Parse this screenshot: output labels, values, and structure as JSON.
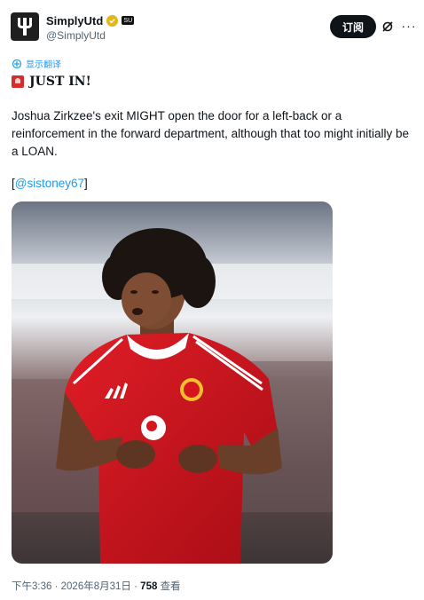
{
  "account": {
    "display_name": "SimplyUtd",
    "handle": "@SimplyUtd",
    "affiliate_label": "SU"
  },
  "actions": {
    "subscribe_label": "订阅",
    "more_label": "···"
  },
  "translate_label": "显示翻译",
  "tweet": {
    "headline": "JUST IN!",
    "body": "Joshua Zirkzee's exit MIGHT open the door for a left-back or a reinforcement in the forward department, although that too might initially be a LOAN.",
    "mention_open": "[",
    "mention": "@sistoney67",
    "mention_close": "]"
  },
  "meta": {
    "time": "下午3:36",
    "date": "2026年8月31日",
    "separator": "·",
    "views_count": "758",
    "views_label": "查看"
  },
  "colors": {
    "link": "#1d9bf0",
    "subscribe_bg": "#0f1419",
    "verified_badge": "#e2b719",
    "kit_red": "#d7151f"
  },
  "icons": [
    "trident-logo-icon",
    "verified-badge-icon",
    "grok-icon",
    "more-icon",
    "translate-icon",
    "siren-icon"
  ]
}
